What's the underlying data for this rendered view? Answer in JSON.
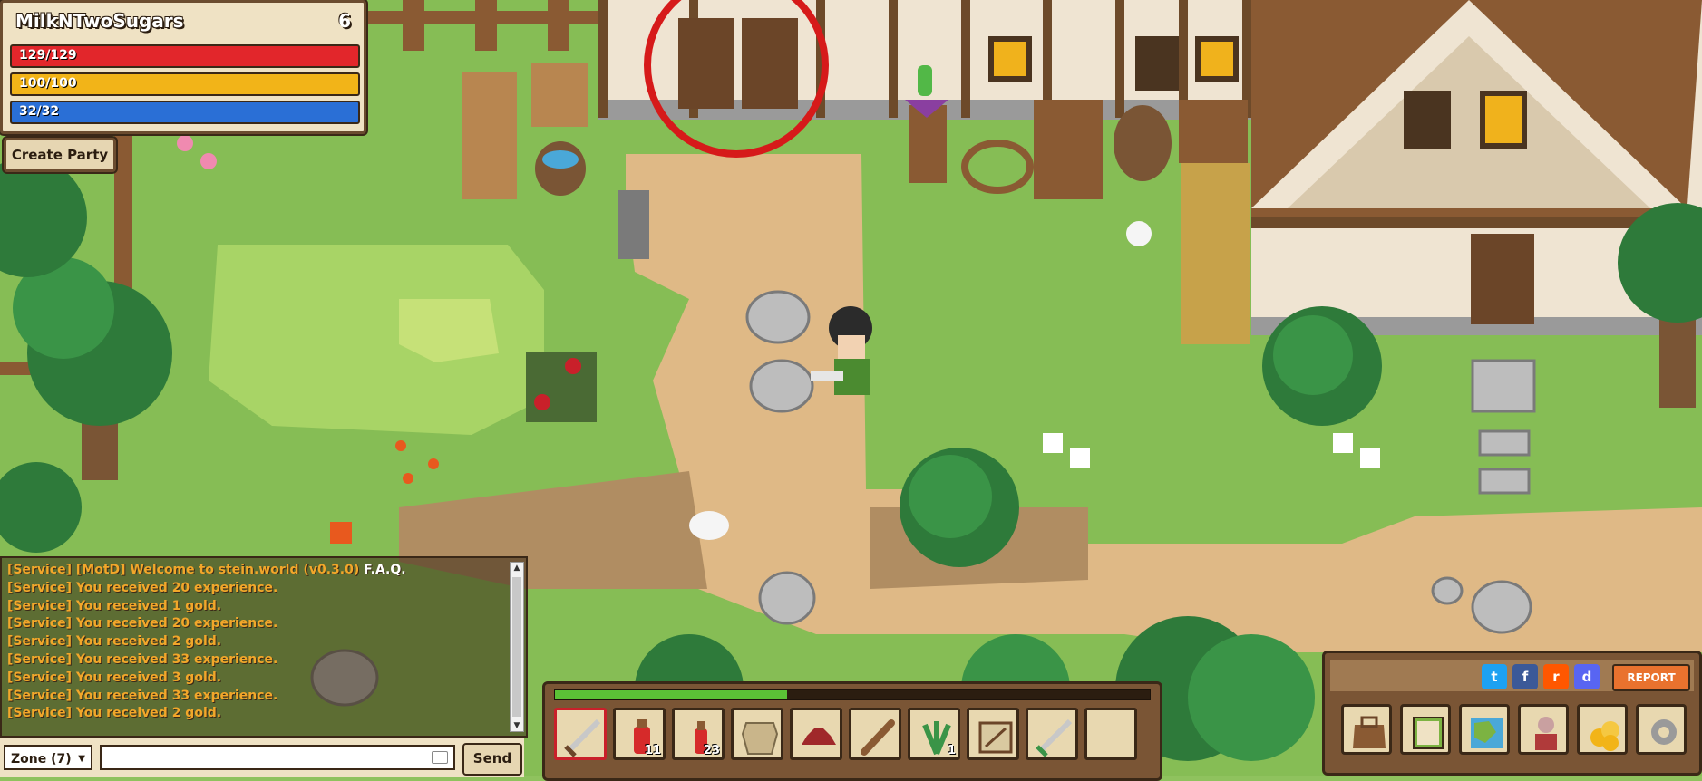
{
  "player": {
    "name": "MilkNTwoSugars",
    "level": "6",
    "hp": {
      "label": "129/129",
      "fraction": 1.0,
      "color": "#e2262b"
    },
    "stamina": {
      "label": "100/100",
      "fraction": 1.0,
      "color": "#f2b418"
    },
    "mana": {
      "label": "32/32",
      "fraction": 1.0,
      "color": "#2a6fd6"
    }
  },
  "party": {
    "create_label": "Create Party"
  },
  "chat": {
    "lines": [
      {
        "text": "[Service] [MotD] Welcome to stein.world (v0.3.0) ",
        "link": "F.A.Q."
      },
      {
        "text": "[Service] You received 20 experience."
      },
      {
        "text": "[Service] You received 1 gold."
      },
      {
        "text": "[Service] You received 20 experience."
      },
      {
        "text": "[Service] You received 2 gold."
      },
      {
        "text": "[Service] You received 33 experience."
      },
      {
        "text": "[Service] You received 3 gold."
      },
      {
        "text": "[Service] You received 33 experience."
      },
      {
        "text": "[Service] You received 2 gold."
      }
    ],
    "zone_label": "Zone (7)",
    "send_label": "Send",
    "input_value": ""
  },
  "hotbar": {
    "xp_fraction": 0.39,
    "slots": [
      {
        "icon": "sword-icon",
        "count": "",
        "selected": true
      },
      {
        "icon": "health-potion-icon",
        "count": "11",
        "selected": false
      },
      {
        "icon": "health-potion-small-icon",
        "count": "23",
        "selected": false
      },
      {
        "icon": "armor-icon",
        "count": "",
        "selected": false
      },
      {
        "icon": "hat-icon",
        "count": "",
        "selected": false
      },
      {
        "icon": "club-icon",
        "count": "",
        "selected": false
      },
      {
        "icon": "herb-icon",
        "count": "1",
        "selected": false
      },
      {
        "icon": "map-scroll-icon",
        "count": "",
        "selected": false
      },
      {
        "icon": "green-sword-icon",
        "count": "",
        "selected": false
      },
      {
        "icon": "empty-slot",
        "count": "",
        "selected": false
      }
    ]
  },
  "social": {
    "icons": [
      "twitter-icon",
      "facebook-icon",
      "reddit-icon",
      "discord-icon"
    ],
    "report_label": "REPORT"
  },
  "menu": {
    "buttons": [
      "inventory-bag-icon",
      "quest-book-icon",
      "world-map-icon",
      "character-icon",
      "gold-icon",
      "settings-gear-icon"
    ]
  },
  "colors": {
    "quest_marker": "#f2a72a",
    "highlight_circle": "#d61a1a"
  }
}
